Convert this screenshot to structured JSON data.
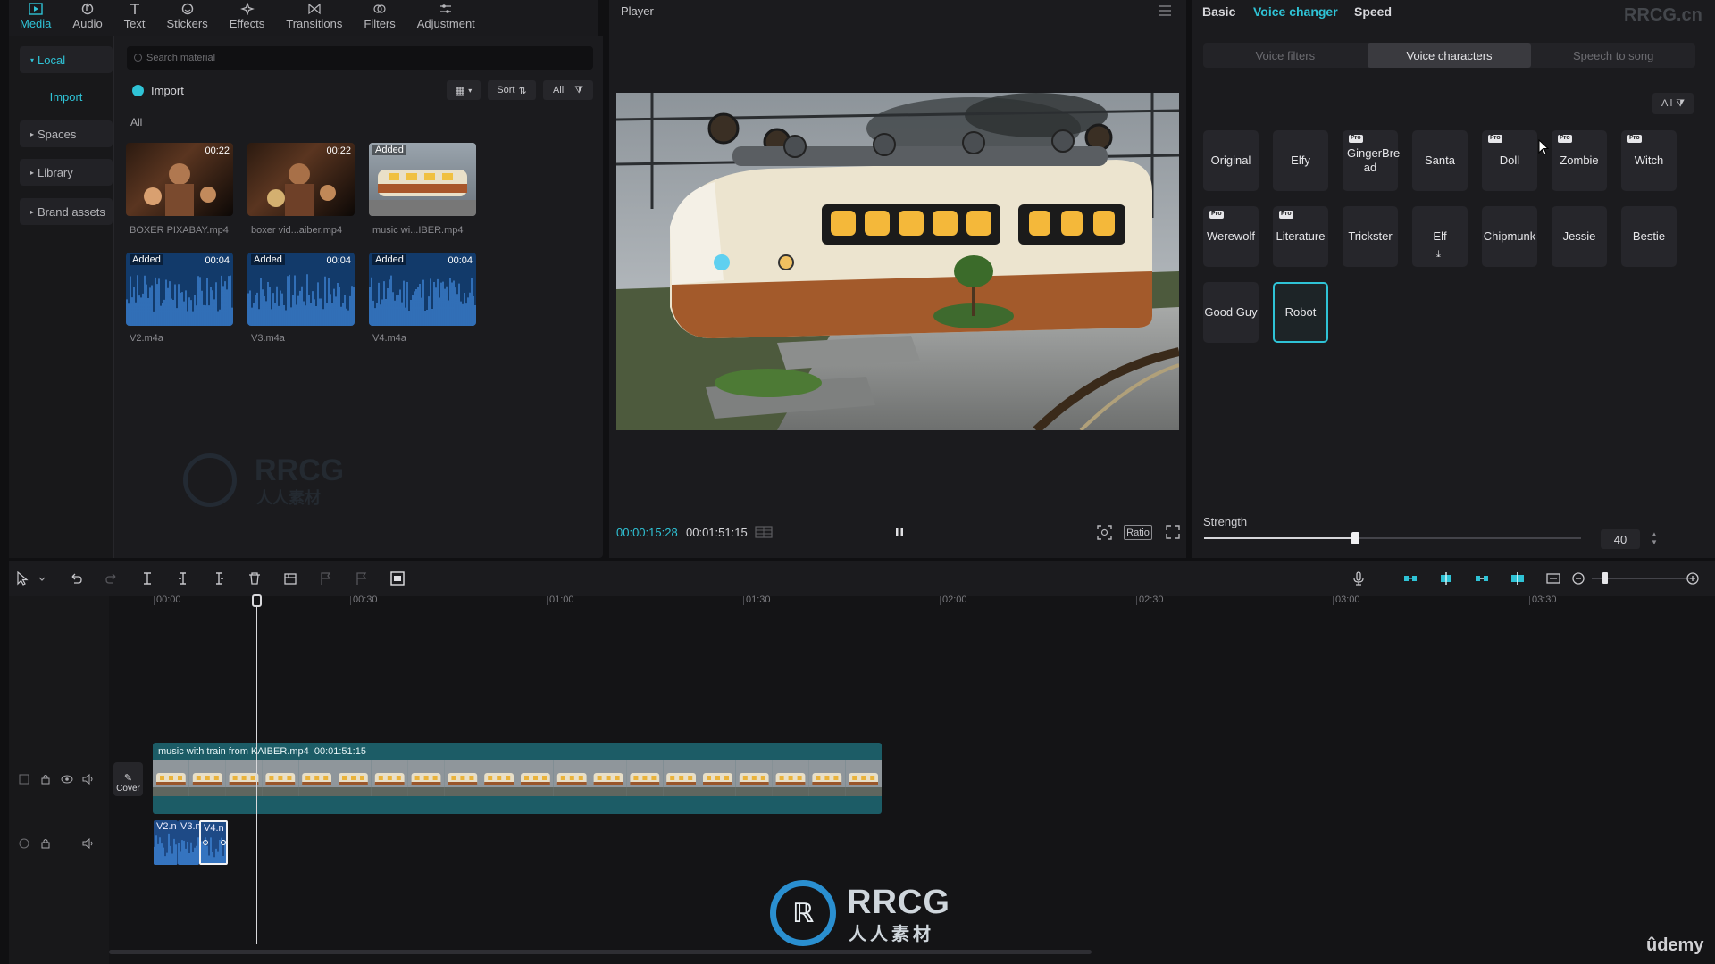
{
  "top_tabs": [
    {
      "label": "Media",
      "icon": "media-icon",
      "active": true
    },
    {
      "label": "Audio",
      "icon": "audio-icon"
    },
    {
      "label": "Text",
      "icon": "text-icon"
    },
    {
      "label": "Stickers",
      "icon": "stickers-icon"
    },
    {
      "label": "Effects",
      "icon": "effects-icon"
    },
    {
      "label": "Transitions",
      "icon": "transitions-icon"
    },
    {
      "label": "Filters",
      "icon": "filters-icon"
    },
    {
      "label": "Adjustment",
      "icon": "adjustment-icon"
    }
  ],
  "sidebar": {
    "local": "Local",
    "import": "Import",
    "spaces": "Spaces",
    "library": "Library",
    "brand_assets": "Brand assets"
  },
  "media": {
    "search_placeholder": "Search material",
    "import_label": "Import",
    "sort_label": "Sort",
    "all_filter": "All",
    "section_label": "All",
    "items": [
      {
        "name": "BOXER PIXABAY.mp4",
        "duration": "00:22",
        "badge": ""
      },
      {
        "name": "boxer vid...aiber.mp4",
        "duration": "00:22",
        "badge": ""
      },
      {
        "name": "music wi...IBER.mp4",
        "duration": "",
        "badge": "Added"
      },
      {
        "name": "V2.m4a",
        "duration": "00:04",
        "badge": "Added"
      },
      {
        "name": "V3.m4a",
        "duration": "00:04",
        "badge": "Added"
      },
      {
        "name": "V4.m4a",
        "duration": "00:04",
        "badge": "Added"
      }
    ]
  },
  "player": {
    "title": "Player",
    "current_time": "00:00:15:28",
    "total_time": "00:01:51:15",
    "ratio_label": "Ratio"
  },
  "voice": {
    "tabs": [
      "Basic",
      "Voice changer",
      "Speed"
    ],
    "active_tab": "Voice changer",
    "sub_tabs": [
      "Voice filters",
      "Voice characters",
      "Speech to song"
    ],
    "active_sub_tab": "Voice characters",
    "filter_all": "All",
    "pro_badge": "Pro",
    "characters": [
      {
        "label": "Original",
        "pro": false
      },
      {
        "label": "Elfy",
        "pro": false
      },
      {
        "label": "GingerBre ad",
        "pro": true
      },
      {
        "label": "Santa",
        "pro": false
      },
      {
        "label": "Doll",
        "pro": true
      },
      {
        "label": "Zombie",
        "pro": true
      },
      {
        "label": "Witch",
        "pro": true
      },
      {
        "label": "Werewolf",
        "pro": true
      },
      {
        "label": "Literature",
        "pro": true
      },
      {
        "label": "Trickster",
        "pro": false
      },
      {
        "label": "Elf",
        "pro": false,
        "download": true
      },
      {
        "label": "Chipmunk",
        "pro": false
      },
      {
        "label": "Jessie",
        "pro": false
      },
      {
        "label": "Bestie",
        "pro": false
      },
      {
        "label": "Good Guy",
        "pro": false
      },
      {
        "label": "Robot",
        "pro": false,
        "selected": true
      }
    ],
    "strength_label": "Strength",
    "strength_value": "40",
    "strength_fraction": 0.4
  },
  "timeline": {
    "ruler": [
      "00:00",
      "00:30",
      "01:00",
      "01:30",
      "02:00",
      "02:30",
      "03:00",
      "03:30"
    ],
    "video_clip_label": "music with train from KAIBER.mp4",
    "video_clip_duration": "00:01:51:15",
    "cover_label": "Cover",
    "audio_clips": [
      "V2.n",
      "V3.n",
      "V4.n"
    ]
  },
  "watermarks": {
    "top_right": "RRCG.cn",
    "center_main": "RRCG",
    "center_sub": "人人素材",
    "corner": "ûdemy"
  },
  "colors": {
    "accent": "#2fc3d6",
    "panel": "#1b1b1e",
    "video_clip": "#1c5c66",
    "audio_clip": "#1e4a86"
  }
}
